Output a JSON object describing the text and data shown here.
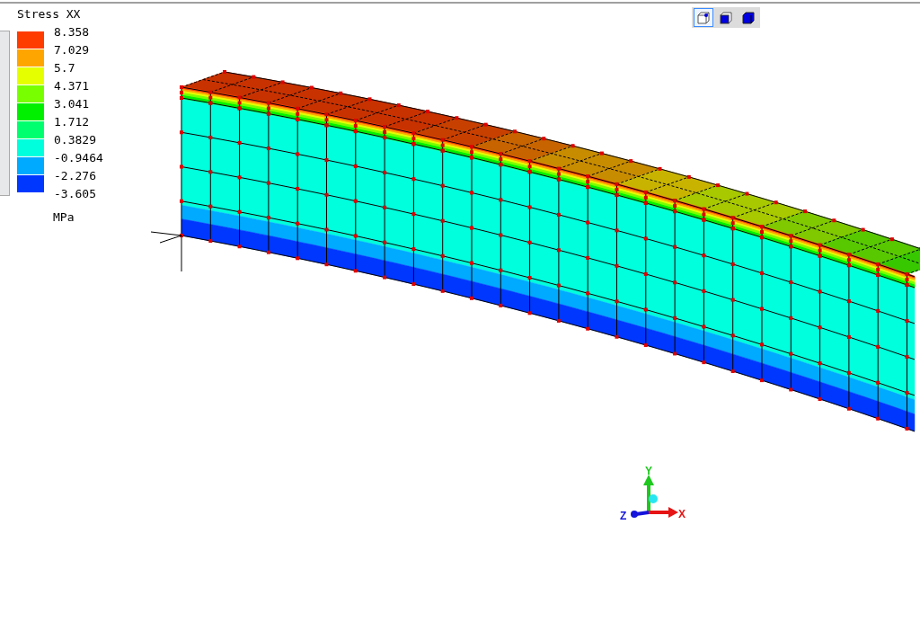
{
  "legend": {
    "title": "Stress XX",
    "unit": "MPa",
    "bands": [
      {
        "color": "#ff3c00"
      },
      {
        "color": "#ffa500"
      },
      {
        "color": "#e6ff00"
      },
      {
        "color": "#78ff00"
      },
      {
        "color": "#00f000"
      },
      {
        "color": "#00ff6e"
      },
      {
        "color": "#00ffdc"
      },
      {
        "color": "#00aaff"
      },
      {
        "color": "#0037ff"
      }
    ],
    "ticks": [
      "8.358",
      "7.029",
      "5.7",
      "4.371",
      "3.041",
      "1.712",
      "0.3829",
      "-0.9464",
      "-2.276",
      "-3.605"
    ]
  },
  "view_toolbar": [
    {
      "kind": "wireframe",
      "selected": true
    },
    {
      "kind": "hidden",
      "selected": false
    },
    {
      "kind": "shaded",
      "selected": false
    }
  ],
  "axes": {
    "x": "X",
    "y": "Y",
    "z": "Z"
  }
}
